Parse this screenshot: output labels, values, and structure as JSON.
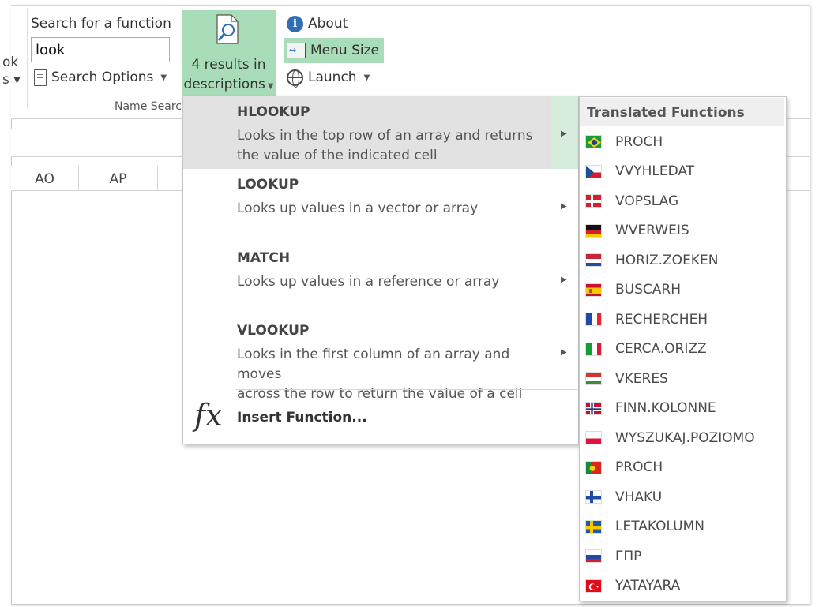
{
  "ribbon": {
    "partial_left_text": [
      "ok",
      "s ▾"
    ],
    "search_label": "Search for a function",
    "search_value": "look",
    "search_options_label": "Search Options",
    "results_line1": "4 results in",
    "results_line2": "descriptions",
    "about_label": "About",
    "menu_size_label": "Menu Size",
    "launch_label": "Launch",
    "group_label": "Name Searc"
  },
  "columns": [
    "AO",
    "AP"
  ],
  "menu": {
    "items": [
      {
        "name": "HLOOKUP",
        "desc": [
          "Looks in the top row of an array and returns",
          "the value of the indicated cell"
        ]
      },
      {
        "name": "LOOKUP",
        "desc": [
          "Looks up values in a vector or array"
        ]
      },
      {
        "name": "MATCH",
        "desc": [
          "Looks up values in a reference or array"
        ]
      },
      {
        "name": "VLOOKUP",
        "desc": [
          "Looks in the first column of an array and moves",
          "across the row to return the value of a cell"
        ]
      }
    ],
    "insert_function_label": "Insert Function..."
  },
  "submenu": {
    "title": "Translated Functions",
    "items": [
      {
        "flag": "brazil",
        "name": "PROCH"
      },
      {
        "flag": "czech",
        "name": "VVYHLEDAT"
      },
      {
        "flag": "denmark",
        "name": "VOPSLAG"
      },
      {
        "flag": "germany",
        "name": "WVERWEIS"
      },
      {
        "flag": "netherlands",
        "name": "HORIZ.ZOEKEN"
      },
      {
        "flag": "spain",
        "name": "BUSCARH"
      },
      {
        "flag": "france",
        "name": "RECHERCHEH"
      },
      {
        "flag": "italy",
        "name": "CERCA.ORIZZ"
      },
      {
        "flag": "hungary",
        "name": "VKERES"
      },
      {
        "flag": "norway",
        "name": "FINN.KOLONNE"
      },
      {
        "flag": "poland",
        "name": "WYSZUKAJ.POZIOMO"
      },
      {
        "flag": "portugal",
        "name": "PROCH"
      },
      {
        "flag": "finland",
        "name": "VHAKU"
      },
      {
        "flag": "sweden",
        "name": "LETAKOLUMN"
      },
      {
        "flag": "russia",
        "name": "ГПР"
      },
      {
        "flag": "turkey",
        "name": "YATAYARA"
      }
    ]
  },
  "colors": {
    "accent_green": "#a9dcb8",
    "highlight_gray": "#e2e2e2"
  }
}
